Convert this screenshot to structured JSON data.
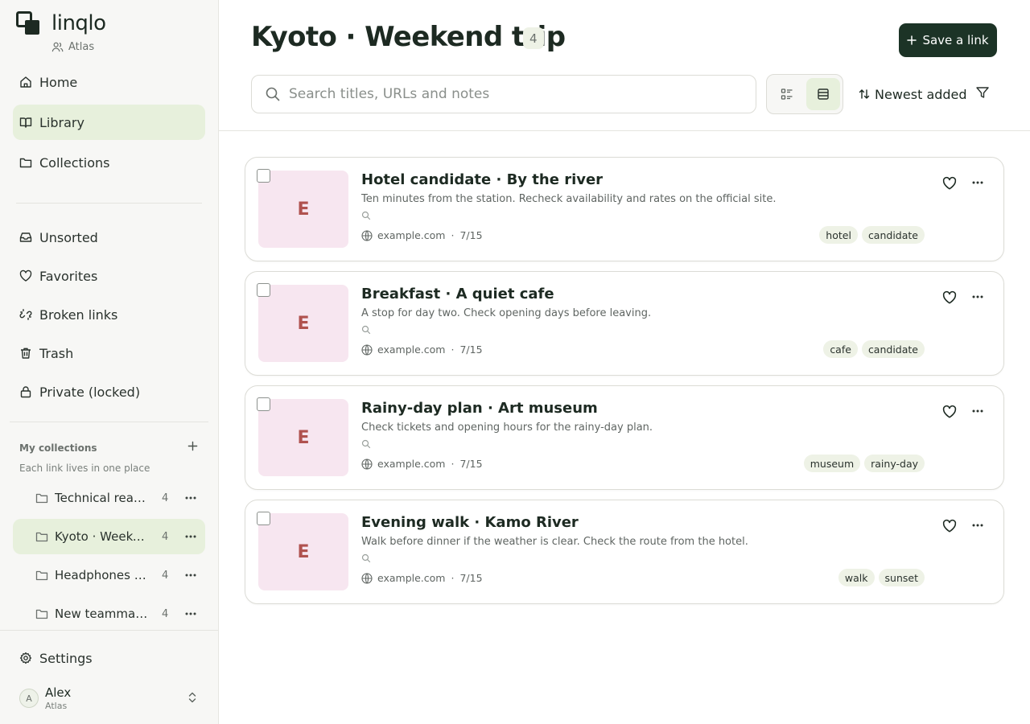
{
  "brand": {
    "name": "linqlo",
    "workspace": "Atlas"
  },
  "nav": {
    "primary": [
      {
        "label": "Home",
        "icon": "home-icon"
      },
      {
        "label": "Library",
        "icon": "book-icon",
        "active": true
      },
      {
        "label": "Collections",
        "icon": "folder-icon"
      }
    ],
    "secondary": [
      {
        "label": "Unsorted",
        "icon": "inbox-icon"
      },
      {
        "label": "Favorites",
        "icon": "heart-icon"
      },
      {
        "label": "Broken links",
        "icon": "broken-link-icon"
      },
      {
        "label": "Trash",
        "icon": "trash-icon"
      },
      {
        "label": "Private (locked)",
        "icon": "lock-icon"
      }
    ]
  },
  "collections": {
    "heading": "My collections",
    "subtitle": "Each link lives in one place",
    "items": [
      {
        "name": "Technical reading list",
        "count": "4"
      },
      {
        "name": "Kyoto · Weekend trip",
        "count": "4",
        "active": true
      },
      {
        "name": "Headphones · Comparison",
        "count": "4"
      },
      {
        "name": "New teammate onboarding",
        "count": "4"
      }
    ]
  },
  "settings_label": "Settings",
  "user": {
    "initial": "A",
    "name": "Alex",
    "workspace": "Atlas"
  },
  "header": {
    "title": "Kyoto · Weekend trip",
    "count": "4",
    "save_label": "Save a link"
  },
  "search": {
    "placeholder": "Search titles, URLs and notes",
    "value": ""
  },
  "view": {
    "options": [
      "list-compact",
      "list-cards"
    ],
    "selected": "list-cards"
  },
  "sort": {
    "label": "Newest added"
  },
  "links": [
    {
      "thumb_letter": "E",
      "title": "Hotel candidate · By the river",
      "description": "Ten minutes from the station. Recheck availability and rates on the official site.",
      "domain": "example.com",
      "date": "7/15",
      "tags": [
        "hotel",
        "candidate"
      ]
    },
    {
      "thumb_letter": "E",
      "title": "Breakfast · A quiet cafe",
      "description": "A stop for day two. Check opening days before leaving.",
      "domain": "example.com",
      "date": "7/15",
      "tags": [
        "cafe",
        "candidate"
      ]
    },
    {
      "thumb_letter": "E",
      "title": "Rainy-day plan · Art museum",
      "description": "Check tickets and opening hours for the rainy-day plan.",
      "domain": "example.com",
      "date": "7/15",
      "tags": [
        "museum",
        "rainy-day"
      ]
    },
    {
      "thumb_letter": "E",
      "title": "Evening walk · Kamo River",
      "description": "Walk before dinner if the weather is clear. Check the route from the hotel.",
      "domain": "example.com",
      "date": "7/15",
      "tags": [
        "walk",
        "sunset"
      ]
    }
  ],
  "colors": {
    "accent_dark": "#1c3326",
    "active_bg": "#e7f0dc",
    "thumb_bg": "#f7e6f0",
    "thumb_letter": "#b0524f",
    "tag_bg": "#eef2e6"
  }
}
